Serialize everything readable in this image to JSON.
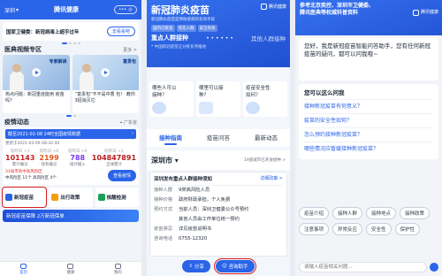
{
  "p1": {
    "location": "深圳",
    "title": "腾讯健康",
    "news_text": "国家卫健委：新冠病毒上超乎过年",
    "news_button": "去看看吧",
    "video_section_title": "医典视频专区",
    "video_section_more": "更多 >",
    "videos": [
      {
        "caption": "热点问题：新冠重症能用 疫苗吗？",
        "overlay": "专家解读"
      },
      {
        "caption": "“富贵包”不不是中香 包！ 教你3招消灭它",
        "overlay": "富贵包"
      }
    ],
    "epidemic_title": "疫情动态",
    "epidemic_region": "广东省",
    "update_text": "截至2021-02-08 24时全国疫情数据",
    "update_sub": "更新于2021-02-09 08:42:44",
    "stats": [
      {
        "delta": "较昨日 +1",
        "value": "101143",
        "label": "累计确诊"
      },
      {
        "delta": "较昨日 +6",
        "value": "2199",
        "label": "现有确诊"
      },
      {
        "delta": "较昨日 +0",
        "value": "788",
        "label": "境外输入"
      },
      {
        "delta": "较昨日 +1",
        "value": "104847891",
        "label": "全球累计"
      }
    ],
    "risk_line1": "31省市有中高风险区",
    "risk_line2": "中风险区 11个 高风险区 4个",
    "map_button": "查看疫情",
    "services": [
      {
        "label": "新冠疫苗",
        "sub": "疫苗接种预约"
      },
      {
        "label": "出行政策",
        "sub": "各地防疫政策"
      },
      {
        "label": "核酸检测",
        "sub": "检测机构预约"
      }
    ],
    "banner_text": "新冠疫苗保障 2万新冠保单",
    "tabbar": [
      "首页",
      "健康",
      "我的"
    ]
  },
  "p2": {
    "title": "新冠肺炎疫苗",
    "logo_text": "腾讯健康",
    "subtitle": "新冠肺炎疫苗是预防疾病的有效手段",
    "tags": [
      "国内已批准",
      "优先人群",
      "安全有效"
    ],
    "queue_primary": "重点人群接种",
    "queue_secondary": "其他人群接种",
    "queue_sub": "* 中国新冠疫苗正分批有序推进",
    "cards": [
      {
        "line1": "哪些人可以",
        "line2": "接种？"
      },
      {
        "line1": "哪里可以接",
        "line2": "种？"
      },
      {
        "line1": "疫苗安全性",
        "line2": "如何？"
      }
    ],
    "tabs": [
      "接种指南",
      "疫苗问答",
      "最新动态"
    ],
    "city": "深圳市",
    "city_note": "19座城市已开放接种 >",
    "notice_title": "深圳发布重点人群接种须知",
    "notice_more": "详细政策 >",
    "notice_rows": [
      {
        "k": "接种人群",
        "v": "9类高风险人员"
      },
      {
        "k": "接种价格",
        "v": "政府财政承担，个人免费"
      },
      {
        "k": "预约方式",
        "v": "当前人员：深圳卫健委公众号预约"
      },
      {
        "k": "",
        "v": "其他人员由工作单位统一预约"
      },
      {
        "k": "疫苗禁忌",
        "v": "详见疫苗说明书"
      },
      {
        "k": "咨询电话",
        "v": "0755-12320"
      }
    ],
    "share_button": "分享",
    "consult_button": "咨询助手"
  },
  "p3": {
    "header_lines": [
      "参考北京疾控、深圳市卫健委、",
      "腾讯医典等权威科普资料"
    ],
    "logo_text": "腾讯健康",
    "greeting": "您好，我是新冠疫苗智能问答助手，您有任何新冠疫苗的疑问，都可以问我哦~",
    "faq_title": "您可以这么问我",
    "faq_items": [
      "接种新冠疫苗有何意义？",
      "疫苗的安全性如何？",
      "怎么预约接种新冠疫苗？",
      "哪些情况应暂缓接种新冠疫苗？"
    ],
    "chips": [
      "疫苗介绍",
      "接种人群",
      "接种地点",
      "接种政策",
      "注意事项",
      "异常反应",
      "安全性",
      "保护性"
    ],
    "input_placeholder": "请输入疫苗相关问题..."
  }
}
